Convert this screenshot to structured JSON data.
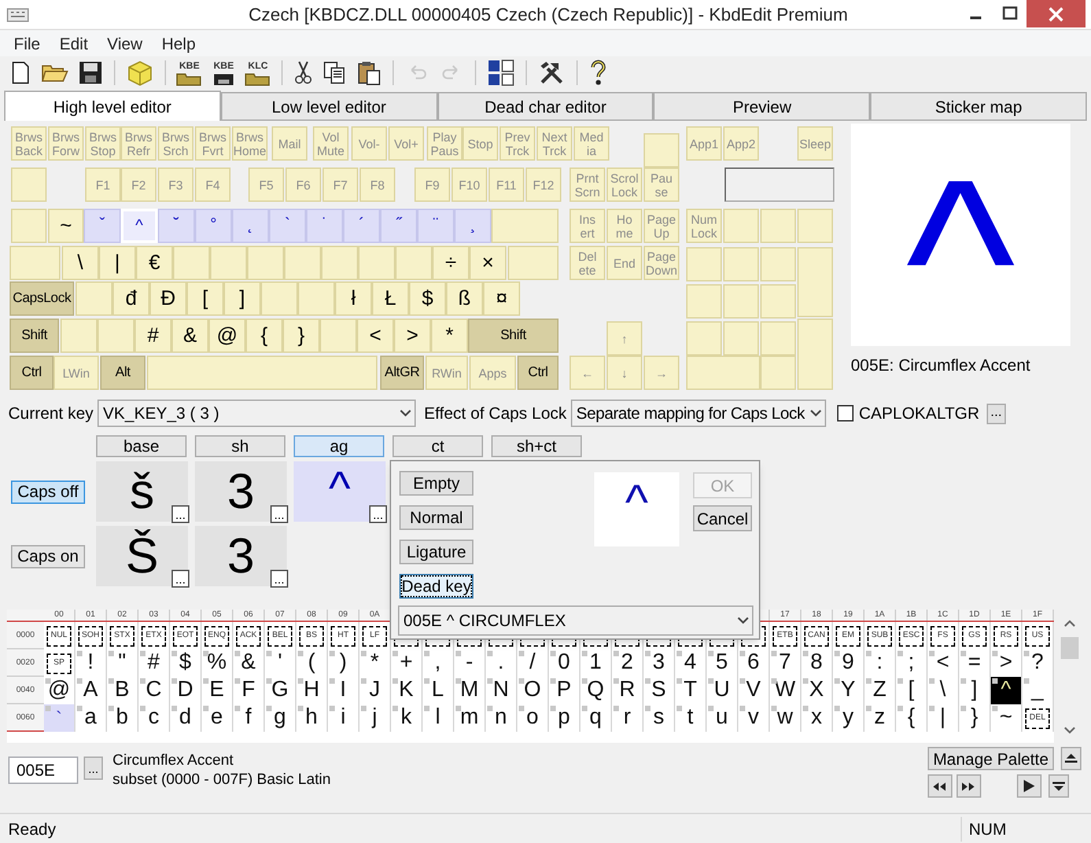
{
  "window": {
    "title": "Czech [KBDCZ.DLL 00000405 Czech (Czech Republic)] - KbdEdit Premium"
  },
  "menu": [
    "File",
    "Edit",
    "View",
    "Help"
  ],
  "toolbar_groups": [
    [
      {
        "disabled": false
      },
      {
        "disabled": false
      },
      {
        "disabled": false
      }
    ],
    [
      {
        "disabled": false
      }
    ],
    [
      {
        "caption": "KBE",
        "disabled": false
      },
      {
        "caption": "KBE",
        "disabled": false
      },
      {
        "caption": "KLC",
        "disabled": false
      }
    ],
    [
      {
        "disabled": false
      },
      {
        "disabled": false
      },
      {
        "disabled": false
      }
    ],
    [
      {
        "disabled": true
      },
      {
        "disabled": true
      }
    ],
    [
      {
        "disabled": false
      }
    ],
    [
      {
        "disabled": false
      }
    ],
    [
      {
        "disabled": false
      }
    ]
  ],
  "tabs": [
    {
      "label": "High level editor",
      "selected": true
    },
    {
      "label": "Low level editor",
      "selected": false
    },
    {
      "label": "Dead char editor",
      "selected": false
    },
    {
      "label": "Preview",
      "selected": false
    },
    {
      "label": "Sticker map",
      "selected": false
    }
  ],
  "keyboard": {
    "keys": [
      {
        "label": "Brws\nBack",
        "kind": "func",
        "selected": false
      },
      {
        "label": "Brws\nForw",
        "kind": "func",
        "selected": false
      },
      {
        "label": "Brws\nStop",
        "kind": "func",
        "selected": false
      },
      {
        "label": "Brws\nRefr",
        "kind": "func",
        "selected": false
      },
      {
        "label": "Brws\nSrch",
        "kind": "func",
        "selected": false
      },
      {
        "label": "Brws\nFvrt",
        "kind": "func",
        "selected": false
      },
      {
        "label": "Brws\nHome",
        "kind": "func",
        "selected": false
      },
      {
        "label": "Mail",
        "kind": "func",
        "selected": false
      },
      {
        "label": "Vol\nMute",
        "kind": "func",
        "selected": false
      },
      {
        "label": "Vol-",
        "kind": "func",
        "selected": false
      },
      {
        "label": "Vol+",
        "kind": "func",
        "selected": false
      },
      {
        "label": "Play\nPaus",
        "kind": "func",
        "selected": false
      },
      {
        "label": "Stop",
        "kind": "func",
        "selected": false
      },
      {
        "label": "Prev\nTrck",
        "kind": "func",
        "selected": false
      },
      {
        "label": "Next\nTrck",
        "kind": "func",
        "selected": false
      },
      {
        "label": "Med\nia",
        "kind": "func",
        "selected": false
      },
      {
        "kind": "blank",
        "selected": false
      },
      {
        "label": "App1",
        "kind": "func",
        "selected": false
      },
      {
        "label": "App2",
        "kind": "func",
        "selected": false
      },
      {
        "label": "Sleep",
        "kind": "func",
        "selected": false
      },
      {
        "kind": "blank",
        "selected": false
      },
      {
        "label": "F1",
        "kind": "func",
        "selected": false
      },
      {
        "label": "F2",
        "kind": "func",
        "selected": false
      },
      {
        "label": "F3",
        "kind": "func",
        "selected": false
      },
      {
        "label": "F4",
        "kind": "func",
        "selected": false
      },
      {
        "label": "F5",
        "kind": "func",
        "selected": false
      },
      {
        "label": "F6",
        "kind": "func",
        "selected": false
      },
      {
        "label": "F7",
        "kind": "func",
        "selected": false
      },
      {
        "label": "F8",
        "kind": "func",
        "selected": false
      },
      {
        "label": "F9",
        "kind": "func",
        "selected": false
      },
      {
        "label": "F10",
        "kind": "func",
        "selected": false
      },
      {
        "label": "F11",
        "kind": "func",
        "selected": false
      },
      {
        "label": "F12",
        "kind": "func",
        "selected": false
      },
      {
        "label": "Prnt\nScrn",
        "kind": "func",
        "selected": false
      },
      {
        "label": "Scrol\nLock",
        "kind": "func",
        "selected": false
      },
      {
        "label": "Pau\nse",
        "kind": "func",
        "selected": false
      },
      {
        "kind": "blank",
        "selected": false
      },
      {
        "label": "~",
        "kind": "char",
        "selected": false
      },
      {
        "label": "ˇ",
        "kind": "dead",
        "selected": false
      },
      {
        "label": "^",
        "kind": "dead",
        "selected": true
      },
      {
        "label": "˘",
        "kind": "dead",
        "selected": false
      },
      {
        "label": "°",
        "kind": "dead",
        "selected": false
      },
      {
        "label": "˛",
        "kind": "dead",
        "selected": false
      },
      {
        "label": "`",
        "kind": "dead",
        "selected": false
      },
      {
        "label": "˙",
        "kind": "dead",
        "selected": false
      },
      {
        "label": "´",
        "kind": "dead",
        "selected": false
      },
      {
        "label": "˝",
        "kind": "dead",
        "selected": false
      },
      {
        "label": "¨",
        "kind": "dead",
        "selected": false
      },
      {
        "label": "¸",
        "kind": "dead",
        "selected": false
      },
      {
        "kind": "blank",
        "selected": false
      },
      {
        "label": "Ins\nert",
        "kind": "func",
        "selected": false
      },
      {
        "label": "Ho\nme",
        "kind": "func",
        "selected": false
      },
      {
        "label": "Page\nUp",
        "kind": "func",
        "selected": false
      },
      {
        "label": "Num\nLock",
        "kind": "func",
        "selected": false
      },
      {
        "kind": "blank",
        "selected": false
      },
      {
        "kind": "blank",
        "selected": false
      },
      {
        "kind": "blank",
        "selected": false
      },
      {
        "kind": "blank",
        "selected": false
      },
      {
        "label": "\\",
        "kind": "char",
        "selected": false
      },
      {
        "label": "|",
        "kind": "char",
        "selected": false
      },
      {
        "label": "€",
        "kind": "char",
        "selected": false
      },
      {
        "kind": "blank",
        "selected": false
      },
      {
        "kind": "blank",
        "selected": false
      },
      {
        "kind": "blank",
        "selected": false
      },
      {
        "kind": "blank",
        "selected": false
      },
      {
        "kind": "blank",
        "selected": false
      },
      {
        "kind": "blank",
        "selected": false
      },
      {
        "kind": "blank",
        "selected": false
      },
      {
        "label": "÷",
        "kind": "char",
        "selected": false
      },
      {
        "label": "×",
        "kind": "char",
        "selected": false
      },
      {
        "kind": "blank",
        "selected": false
      },
      {
        "label": "Del\nete",
        "kind": "func",
        "selected": false
      },
      {
        "label": "End",
        "kind": "func",
        "selected": false
      },
      {
        "label": "Page\nDown",
        "kind": "func",
        "selected": false
      },
      {
        "kind": "blank",
        "selected": false
      },
      {
        "kind": "blank",
        "selected": false
      },
      {
        "kind": "blank",
        "selected": false
      },
      {
        "kind": "blank",
        "selected": false
      },
      {
        "label": "CapsLock",
        "kind": "mod",
        "selected": false
      },
      {
        "kind": "blank",
        "selected": false
      },
      {
        "label": "đ",
        "kind": "char",
        "selected": false
      },
      {
        "label": "Đ",
        "kind": "char",
        "selected": false
      },
      {
        "label": "[",
        "kind": "char",
        "selected": false
      },
      {
        "label": "]",
        "kind": "char",
        "selected": false
      },
      {
        "kind": "blank",
        "selected": false
      },
      {
        "kind": "blank",
        "selected": false
      },
      {
        "label": "ł",
        "kind": "char",
        "selected": false
      },
      {
        "label": "Ł",
        "kind": "char",
        "selected": false
      },
      {
        "label": "$",
        "kind": "char",
        "selected": false
      },
      {
        "label": "ß",
        "kind": "char",
        "selected": false
      },
      {
        "label": "¤",
        "kind": "char",
        "selected": false
      },
      {
        "kind": "blank",
        "selected": false
      },
      {
        "kind": "blank",
        "selected": false
      },
      {
        "kind": "blank",
        "selected": false
      },
      {
        "label": "Shift",
        "kind": "mod",
        "selected": false
      },
      {
        "kind": "blank",
        "selected": false
      },
      {
        "kind": "blank",
        "selected": false
      },
      {
        "label": "#",
        "kind": "char",
        "selected": false
      },
      {
        "label": "&",
        "kind": "char",
        "selected": false
      },
      {
        "label": "@",
        "kind": "char",
        "selected": false
      },
      {
        "label": "{",
        "kind": "char",
        "selected": false
      },
      {
        "label": "}",
        "kind": "char",
        "selected": false
      },
      {
        "kind": "blank",
        "selected": false
      },
      {
        "label": "<",
        "kind": "char",
        "selected": false
      },
      {
        "label": ">",
        "kind": "char",
        "selected": false
      },
      {
        "label": "*",
        "kind": "char",
        "selected": false
      },
      {
        "label": "Shift",
        "kind": "mod",
        "selected": false
      },
      {
        "label": "↑",
        "kind": "func",
        "selected": false
      },
      {
        "kind": "blank",
        "selected": false
      },
      {
        "kind": "blank",
        "selected": false
      },
      {
        "kind": "blank",
        "selected": false
      },
      {
        "kind": "blank",
        "selected": false
      },
      {
        "label": "Ctrl",
        "kind": "mod",
        "selected": false
      },
      {
        "label": "LWin",
        "kind": "func",
        "selected": false
      },
      {
        "label": "Alt",
        "kind": "mod",
        "selected": false
      },
      {
        "kind": "blank",
        "selected": false
      },
      {
        "label": "AltGR",
        "kind": "mod",
        "selected": false
      },
      {
        "label": "RWin",
        "kind": "func",
        "selected": false
      },
      {
        "label": "Apps",
        "kind": "func",
        "selected": false
      },
      {
        "label": "Ctrl",
        "kind": "mod",
        "selected": false
      },
      {
        "label": "←",
        "kind": "func",
        "selected": false
      },
      {
        "label": "↓",
        "kind": "func",
        "selected": false
      },
      {
        "label": "→",
        "kind": "func",
        "selected": false
      },
      {
        "kind": "blank",
        "selected": false
      },
      {
        "kind": "blank",
        "selected": false
      }
    ]
  },
  "preview": {
    "glyph": "^",
    "caption": "005E: Circumflex Accent"
  },
  "current_key": {
    "label": "Current key",
    "value": "VK_KEY_3 ( 3 )"
  },
  "caps_effect": {
    "label": "Effect of Caps Lock",
    "value": "Separate mapping for Caps Lock"
  },
  "caplok_altgr": {
    "label": "CAPLOKALTGR",
    "checked": false,
    "button": "..."
  },
  "shift_columns": [
    {
      "label": "base",
      "selected": false
    },
    {
      "label": "sh",
      "selected": false
    },
    {
      "label": "ag",
      "selected": true
    },
    {
      "label": "ct",
      "selected": false
    },
    {
      "label": "sh+ct",
      "selected": false
    }
  ],
  "caps_rows": [
    {
      "label": "Caps off",
      "selected": true,
      "cells": [
        {
          "char": "š",
          "kind": "char",
          "button": "..."
        },
        {
          "char": "3",
          "kind": "char",
          "button": "..."
        },
        {
          "char": "^",
          "kind": "dead",
          "button": "..."
        }
      ]
    },
    {
      "label": "Caps on",
      "selected": false,
      "cells": [
        {
          "char": "Š",
          "kind": "char",
          "button": "..."
        },
        {
          "char": "3",
          "kind": "char",
          "button": "..."
        }
      ]
    }
  ],
  "popup": {
    "modes": [
      {
        "label": "Empty",
        "selected": false
      },
      {
        "label": "Normal",
        "selected": false
      },
      {
        "label": "Ligature",
        "selected": false
      },
      {
        "label": "Dead key",
        "selected": true
      }
    ],
    "glyph": "^",
    "ok": {
      "label": "OK",
      "disabled": true
    },
    "cancel": {
      "label": "Cancel",
      "disabled": false
    },
    "dropdown": "005E ^ CIRCUMFLEX"
  },
  "char_grid": {
    "columns": [
      "00",
      "01",
      "02",
      "03",
      "04",
      "05",
      "06",
      "07",
      "08",
      "09",
      "0A",
      null,
      null,
      null,
      null,
      null,
      null,
      null,
      null,
      null,
      null,
      null,
      null,
      "17",
      "18",
      "19",
      "1A",
      "1B",
      "1C",
      "1D",
      "1E",
      "1F"
    ],
    "rows": [
      {
        "label": "0000",
        "cells": [
          {
            "label": "NUL",
            "kind": "control",
            "selected": false
          },
          {
            "label": "SOH",
            "kind": "control",
            "selected": false
          },
          {
            "label": "STX",
            "kind": "control",
            "selected": false
          },
          {
            "label": "ETX",
            "kind": "control",
            "selected": false
          },
          {
            "label": "EOT",
            "kind": "control",
            "selected": false
          },
          {
            "label": "ENQ",
            "kind": "control",
            "selected": false
          },
          {
            "label": "ACK",
            "kind": "control",
            "selected": false
          },
          {
            "label": "BEL",
            "kind": "control",
            "selected": false
          },
          {
            "label": "BS",
            "kind": "control",
            "selected": false
          },
          {
            "label": "HT",
            "kind": "control",
            "selected": false
          },
          {
            "label": "LF",
            "kind": "control",
            "selected": false
          },
          {
            "kind": "control",
            "selected": false
          },
          {
            "kind": "control",
            "selected": false
          },
          {
            "kind": "control",
            "selected": false
          },
          {
            "kind": "control",
            "selected": false
          },
          {
            "kind": "control",
            "selected": false
          },
          {
            "kind": "control",
            "selected": false
          },
          {
            "kind": "control",
            "selected": false
          },
          {
            "kind": "control",
            "selected": false
          },
          {
            "kind": "control",
            "selected": false
          },
          {
            "kind": "control",
            "selected": false
          },
          {
            "kind": "control",
            "selected": false
          },
          {
            "kind": "control",
            "selected": false
          },
          {
            "label": "ETB",
            "kind": "control",
            "selected": false
          },
          {
            "label": "CAN",
            "kind": "control",
            "selected": false
          },
          {
            "label": "EM",
            "kind": "control",
            "selected": false
          },
          {
            "label": "SUB",
            "kind": "control",
            "selected": false
          },
          {
            "label": "ESC",
            "kind": "control",
            "selected": false
          },
          {
            "label": "FS",
            "kind": "control",
            "selected": false
          },
          {
            "label": "GS",
            "kind": "control",
            "selected": false
          },
          {
            "label": "RS",
            "kind": "control",
            "selected": false
          },
          {
            "label": "US",
            "kind": "control",
            "selected": false
          }
        ]
      },
      {
        "label": "0020",
        "cells": [
          {
            "label": "SP",
            "kind": "control",
            "selected": false
          },
          {
            "label": "!",
            "kind": "char",
            "selected": false
          },
          {
            "label": "\"",
            "kind": "char",
            "selected": false
          },
          {
            "label": "#",
            "kind": "char",
            "selected": false
          },
          {
            "label": "$",
            "kind": "char",
            "selected": false
          },
          {
            "label": "%",
            "kind": "char",
            "selected": false
          },
          {
            "label": "&",
            "kind": "char",
            "selected": false
          },
          {
            "label": "'",
            "kind": "char",
            "selected": false
          },
          {
            "label": "(",
            "kind": "char",
            "selected": false
          },
          {
            "label": ")",
            "kind": "char",
            "selected": false
          },
          {
            "label": "*",
            "kind": "char",
            "selected": false
          },
          {
            "label": "+",
            "kind": "char",
            "selected": false
          },
          {
            "label": ",",
            "kind": "char",
            "selected": false
          },
          {
            "label": "-",
            "kind": "char",
            "selected": false
          },
          {
            "label": ".",
            "kind": "char",
            "selected": false
          },
          {
            "label": "/",
            "kind": "char",
            "selected": false
          },
          {
            "label": "0",
            "kind": "char",
            "selected": false
          },
          {
            "label": "1",
            "kind": "char",
            "selected": false
          },
          {
            "label": "2",
            "kind": "char",
            "selected": false
          },
          {
            "label": "3",
            "kind": "char",
            "selected": false
          },
          {
            "label": "4",
            "kind": "char",
            "selected": false
          },
          {
            "label": "5",
            "kind": "char",
            "selected": false
          },
          {
            "label": "6",
            "kind": "char",
            "selected": false
          },
          {
            "label": "7",
            "kind": "char",
            "selected": false
          },
          {
            "label": "8",
            "kind": "char",
            "selected": false
          },
          {
            "label": "9",
            "kind": "char",
            "selected": false
          },
          {
            "label": ":",
            "kind": "char",
            "selected": false
          },
          {
            "label": ";",
            "kind": "char",
            "selected": false
          },
          {
            "label": "<",
            "kind": "char",
            "selected": false
          },
          {
            "label": "=",
            "kind": "char",
            "selected": false
          },
          {
            "label": ">",
            "kind": "char",
            "selected": false
          },
          {
            "label": "?",
            "kind": "char",
            "selected": false
          }
        ]
      },
      {
        "label": "0040",
        "cells": [
          {
            "label": "@",
            "kind": "char",
            "selected": false
          },
          {
            "label": "A",
            "kind": "char",
            "selected": false
          },
          {
            "label": "B",
            "kind": "char",
            "selected": false
          },
          {
            "label": "C",
            "kind": "char",
            "selected": false
          },
          {
            "label": "D",
            "kind": "char",
            "selected": false
          },
          {
            "label": "E",
            "kind": "char",
            "selected": false
          },
          {
            "label": "F",
            "kind": "char",
            "selected": false
          },
          {
            "label": "G",
            "kind": "char",
            "selected": false
          },
          {
            "label": "H",
            "kind": "char",
            "selected": false
          },
          {
            "label": "I",
            "kind": "char",
            "selected": false
          },
          {
            "label": "J",
            "kind": "char",
            "selected": false
          },
          {
            "label": "K",
            "kind": "char",
            "selected": false
          },
          {
            "label": "L",
            "kind": "char",
            "selected": false
          },
          {
            "label": "M",
            "kind": "char",
            "selected": false
          },
          {
            "label": "N",
            "kind": "char",
            "selected": false
          },
          {
            "label": "O",
            "kind": "char",
            "selected": false
          },
          {
            "label": "P",
            "kind": "char",
            "selected": false
          },
          {
            "label": "Q",
            "kind": "char",
            "selected": false
          },
          {
            "label": "R",
            "kind": "char",
            "selected": false
          },
          {
            "label": "S",
            "kind": "char",
            "selected": false
          },
          {
            "label": "T",
            "kind": "char",
            "selected": false
          },
          {
            "label": "U",
            "kind": "char",
            "selected": false
          },
          {
            "label": "V",
            "kind": "char",
            "selected": false
          },
          {
            "label": "W",
            "kind": "char",
            "selected": false
          },
          {
            "label": "X",
            "kind": "char",
            "selected": false
          },
          {
            "label": "Y",
            "kind": "char",
            "selected": false
          },
          {
            "label": "Z",
            "kind": "char",
            "selected": false
          },
          {
            "label": "[",
            "kind": "char",
            "selected": false
          },
          {
            "label": "\\",
            "kind": "char",
            "selected": false
          },
          {
            "label": "]",
            "kind": "char",
            "selected": false
          },
          {
            "label": "^",
            "kind": "char",
            "selected": true
          },
          {
            "label": "_",
            "kind": "char",
            "selected": false
          }
        ]
      },
      {
        "label": "0060",
        "cells": [
          {
            "label": "`",
            "kind": "dead",
            "selected": false
          },
          {
            "label": "a",
            "kind": "char",
            "selected": false
          },
          {
            "label": "b",
            "kind": "char",
            "selected": false
          },
          {
            "label": "c",
            "kind": "char",
            "selected": false
          },
          {
            "label": "d",
            "kind": "char",
            "selected": false
          },
          {
            "label": "e",
            "kind": "char",
            "selected": false
          },
          {
            "label": "f",
            "kind": "char",
            "selected": false
          },
          {
            "label": "g",
            "kind": "char",
            "selected": false
          },
          {
            "label": "h",
            "kind": "char",
            "selected": false
          },
          {
            "label": "i",
            "kind": "char",
            "selected": false
          },
          {
            "label": "j",
            "kind": "char",
            "selected": false
          },
          {
            "label": "k",
            "kind": "char",
            "selected": false
          },
          {
            "label": "l",
            "kind": "char",
            "selected": false
          },
          {
            "label": "m",
            "kind": "char",
            "selected": false
          },
          {
            "label": "n",
            "kind": "char",
            "selected": false
          },
          {
            "label": "o",
            "kind": "char",
            "selected": false
          },
          {
            "label": "p",
            "kind": "char",
            "selected": false
          },
          {
            "label": "q",
            "kind": "char",
            "selected": false
          },
          {
            "label": "r",
            "kind": "char",
            "selected": false
          },
          {
            "label": "s",
            "kind": "char",
            "selected": false
          },
          {
            "label": "t",
            "kind": "char",
            "selected": false
          },
          {
            "label": "u",
            "kind": "char",
            "selected": false
          },
          {
            "label": "v",
            "kind": "char",
            "selected": false
          },
          {
            "label": "w",
            "kind": "char",
            "selected": false
          },
          {
            "label": "x",
            "kind": "char",
            "selected": false
          },
          {
            "label": "y",
            "kind": "char",
            "selected": false
          },
          {
            "label": "z",
            "kind": "char",
            "selected": false
          },
          {
            "label": "{",
            "kind": "char",
            "selected": false
          },
          {
            "label": "|",
            "kind": "char",
            "selected": false
          },
          {
            "label": "}",
            "kind": "char",
            "selected": false
          },
          {
            "label": "~",
            "kind": "char",
            "selected": false
          },
          {
            "label": "DEL",
            "kind": "control",
            "selected": false
          }
        ]
      }
    ]
  },
  "char_info": {
    "code": "005E",
    "button": "...",
    "name": "Circumflex Accent",
    "subset": "subset (0000 - 007F) Basic Latin"
  },
  "palette": {
    "manage": "Manage Palette"
  },
  "status_bar": {
    "text": "Ready",
    "num": "NUM"
  }
}
